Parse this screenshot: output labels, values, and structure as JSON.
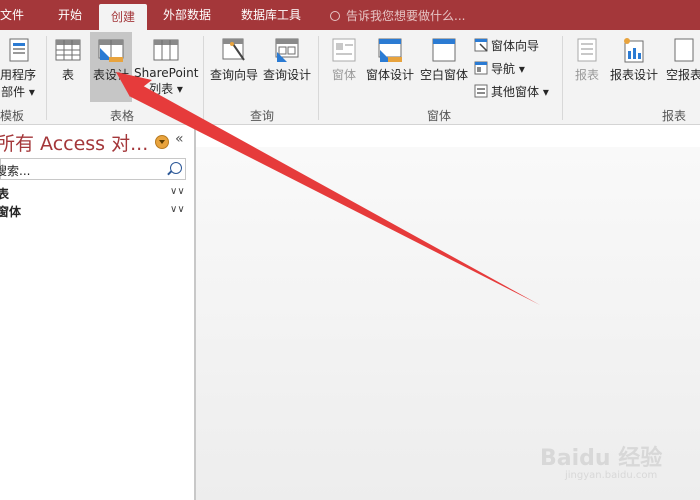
{
  "tabs": {
    "file": "文件",
    "home": "开始",
    "create": "创建",
    "external": "外部数据",
    "dbtools": "数据库工具",
    "tell_me": "告诉我您想要做什么..."
  },
  "ribbon": {
    "app_parts": {
      "line1": "用程序",
      "line2": "部件 ▾"
    },
    "table": "表",
    "table_design": "表设计",
    "sharepoint": {
      "line1": "SharePoint",
      "line2": "列表 ▾"
    },
    "query_wizard": "查询向导",
    "query_design": "查询设计",
    "form": "窗体",
    "form_design": "窗体设计",
    "blank_form": "空白窗体",
    "form_wizard": "窗体向导",
    "navigation": "导航 ▾",
    "more_forms": "其他窗体 ▾",
    "report": "报表",
    "report_design": "报表设计",
    "blank_report": "空报表",
    "groups": {
      "templates": "模板",
      "tables": "表格",
      "queries": "查询",
      "forms": "窗体",
      "reports": "报表"
    }
  },
  "nav": {
    "title": "所有 Access 对...",
    "collapse": "«",
    "search_placeholder": "搜索...",
    "categories": [
      {
        "label": "表"
      },
      {
        "label": "窗体"
      }
    ]
  },
  "watermark": {
    "brand": "Baidu 经验",
    "url": "jingyan.baidu.com"
  },
  "colors": {
    "accent": "#a4373a",
    "arrow": "#e63b3b"
  }
}
